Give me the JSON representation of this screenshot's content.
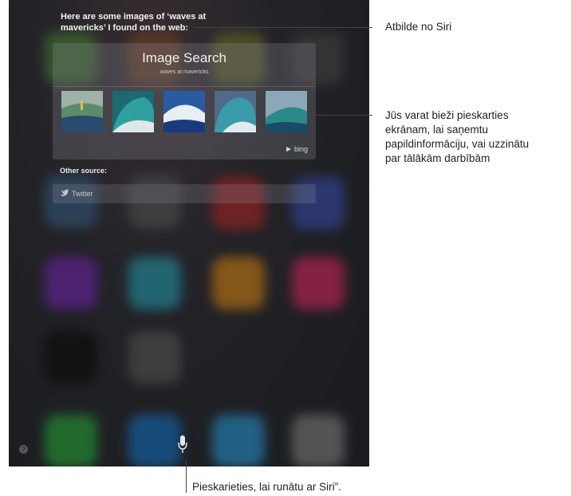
{
  "siri": {
    "response_line1": "Here are some images of ‘waves at",
    "response_line2": "mavericks’ I found on the web:"
  },
  "image_search": {
    "title": "Image Search",
    "query": "waves at mavericks",
    "provider": "bing"
  },
  "other_source": {
    "heading": "Other source:",
    "twitter_label": "Twitter"
  },
  "buttons": {
    "help": "?"
  },
  "callouts": {
    "answer": "Atbilde no Siri",
    "tap_line1": "Jūs varat bieži pieskarties",
    "tap_line2": "ekrānam, lai saņemtu",
    "tap_line3": "papildinformāciju, vai uzzinātu",
    "tap_line4": "par tālākām darbībām",
    "mic": "Pieskarieties, lai runātu ar Siri”."
  },
  "icons": [
    "bing-icon",
    "twitter-icon",
    "microphone-icon",
    "help-icon"
  ]
}
